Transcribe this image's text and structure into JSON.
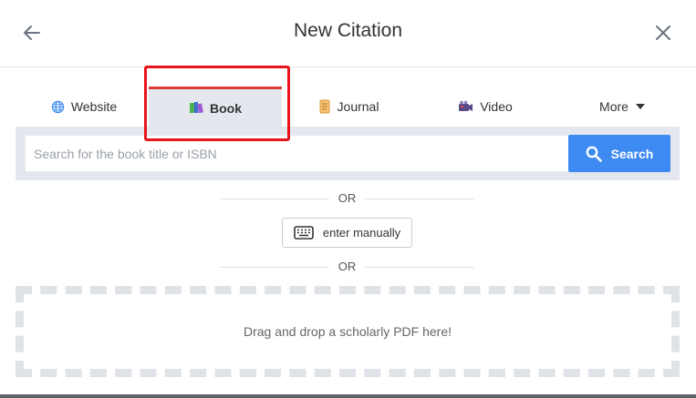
{
  "header": {
    "title": "New Citation",
    "back_icon": "arrow-left-icon",
    "close_icon": "close-icon"
  },
  "tabs": [
    {
      "label": "Website",
      "icon": "globe-icon",
      "selected": false
    },
    {
      "label": "Book",
      "icon": "book-icon",
      "selected": true
    },
    {
      "label": "Journal",
      "icon": "scroll-icon",
      "selected": false
    },
    {
      "label": "Video",
      "icon": "film-camera-icon",
      "selected": false
    },
    {
      "label": "More",
      "icon": "caret-down-icon",
      "selected": false
    }
  ],
  "search": {
    "placeholder": "Search for the book title or ISBN",
    "value": "",
    "button_label": "Search"
  },
  "divider_text": "OR",
  "manual_button_label": "enter manually",
  "dropzone_text": "Drag and drop a scholarly PDF here!",
  "colors": {
    "accent": "#3d8bf2",
    "tab_selected_bg": "#e4e8ee",
    "tab_selected_border": "#dd3b36",
    "highlight": "#e8141b"
  }
}
